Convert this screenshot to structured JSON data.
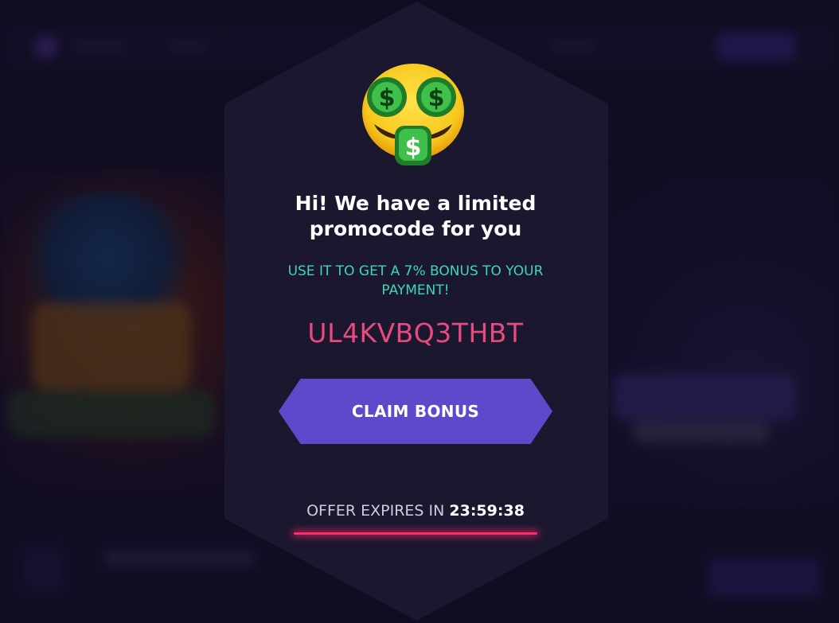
{
  "promo": {
    "title": "Hi! We have a limited promocode for you",
    "subtitle": "USE IT TO GET A 7% BONUS TO YOUR PAYMENT!",
    "code": "UL4KVBQ3THBT",
    "claim_label": "CLAIM BONUS",
    "expires_label": "OFFER EXPIRES IN",
    "timer": "23:59:38",
    "icon": "money-mouth-face-icon"
  },
  "colors": {
    "modal_bg": "#1b172e",
    "title": "#ffffff",
    "subtitle": "#3fd6b8",
    "code": "#e64a7e",
    "claim_button": "#5d4acb",
    "underline": "#ff2a6a"
  }
}
